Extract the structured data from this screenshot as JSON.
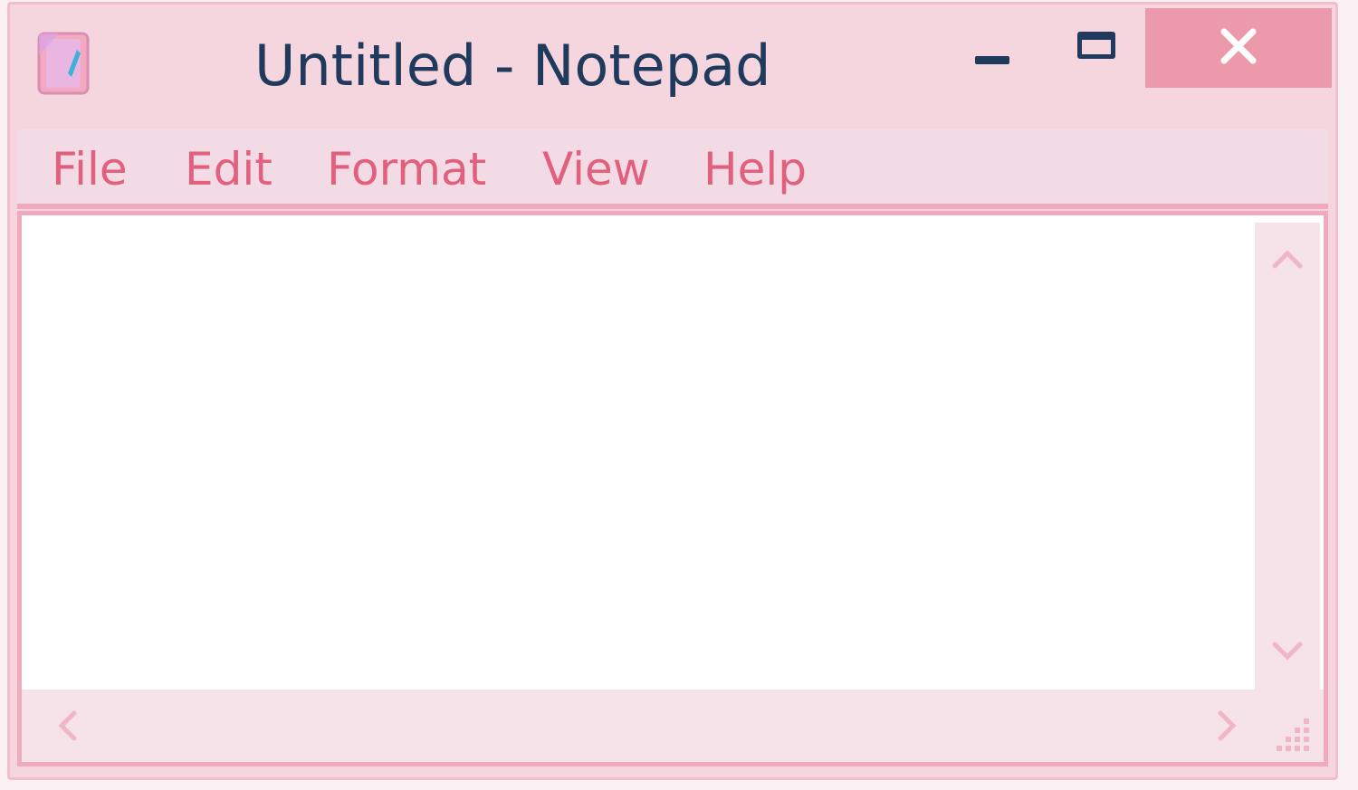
{
  "window": {
    "title": "Untitled - Notepad",
    "icon": "notepad-icon"
  },
  "titlebar_buttons": {
    "minimize_icon": "minimize-icon",
    "maximize_icon": "maximize-icon",
    "close_icon": "close-icon"
  },
  "menu": {
    "items": [
      {
        "label": "File"
      },
      {
        "label": "Edit"
      },
      {
        "label": "Format"
      },
      {
        "label": "View"
      },
      {
        "label": "Help"
      }
    ]
  },
  "editor": {
    "text": ""
  },
  "colors": {
    "window_bg": "#f5d6de",
    "title_text": "#1f3a5c",
    "menu_text": "#e0607e",
    "close_button": "#ec9aab",
    "border": "#f0a9bd"
  }
}
